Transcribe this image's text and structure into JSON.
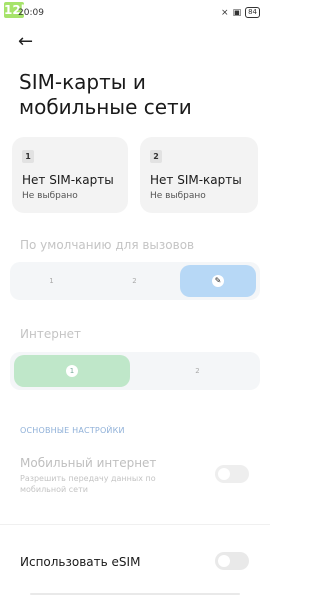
{
  "status_bar": {
    "badge": "12b",
    "time": "20:09",
    "icons": [
      "signal-muted-icon",
      "sim-icon",
      "battery-icon"
    ],
    "battery": "84"
  },
  "header": {
    "back_icon": "arrow-left-icon",
    "title": "SIM-карты и мобильные сети"
  },
  "sim_cards": [
    {
      "number": "1",
      "name": "Нет SIM-карты",
      "status": "Не выбрано"
    },
    {
      "number": "2",
      "name": "Нет SIM-карты",
      "status": "Не выбрано"
    }
  ],
  "calls_default": {
    "label": "По умолчанию для вызовов",
    "options": [
      "1",
      "2",
      "edit"
    ],
    "selected_index": 2,
    "selected_color": "#b7d8f6"
  },
  "internet": {
    "label": "Интернет",
    "options": [
      "1",
      "2"
    ],
    "selected_index": 0,
    "selected_color": "#bfe7c9"
  },
  "basic_settings": {
    "section_label": "ОСНОВНЫЕ НАСТРОЙКИ",
    "mobile_internet": {
      "title": "Мобильный интернет",
      "subtitle": "Разрешить передачу данных по мобильной сети",
      "enabled": false
    }
  },
  "esim": {
    "label": "Использовать eSIM",
    "enabled": false
  },
  "colors": {
    "accent_blue": "#b7d8f6",
    "accent_green": "#bfe7c9",
    "section_caption": "#8fb0d8"
  }
}
